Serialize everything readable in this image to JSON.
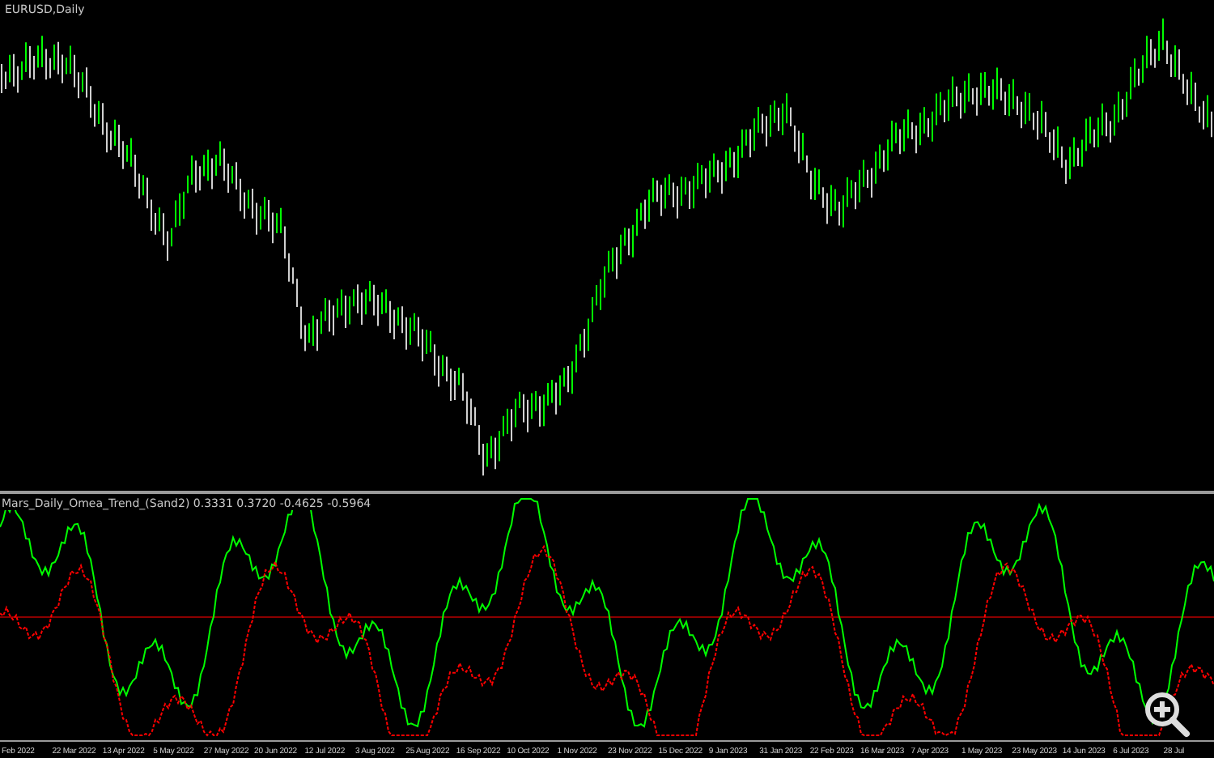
{
  "chart": {
    "title": "EURUSD,Daily"
  },
  "indicator": {
    "label": "Mars_Daily_Omea_Trend_(Sand2) 0.3331 0.3720 -0.4625 -0.5964"
  },
  "time_axis": {
    "labels": [
      "Feb 2022",
      "22 Mar 2022",
      "13 Apr 2022",
      "5 May 2022",
      "27 May 2022",
      "20 Jun 2022",
      "12 Jul 2022",
      "3 Aug 2022",
      "25 Aug 2022",
      "16 Sep 2022",
      "10 Oct 2022",
      "1 Nov 2022",
      "23 Nov 2022",
      "15 Dec 2022",
      "9 Jan 2023",
      "31 Jan 2023",
      "22 Feb 2023",
      "16 Mar 2023",
      "7 Apr 2023",
      "1 May 2023",
      "23 May 2023",
      "14 Jun 2023",
      "6 Jul 2023",
      "28 Jul"
    ]
  }
}
